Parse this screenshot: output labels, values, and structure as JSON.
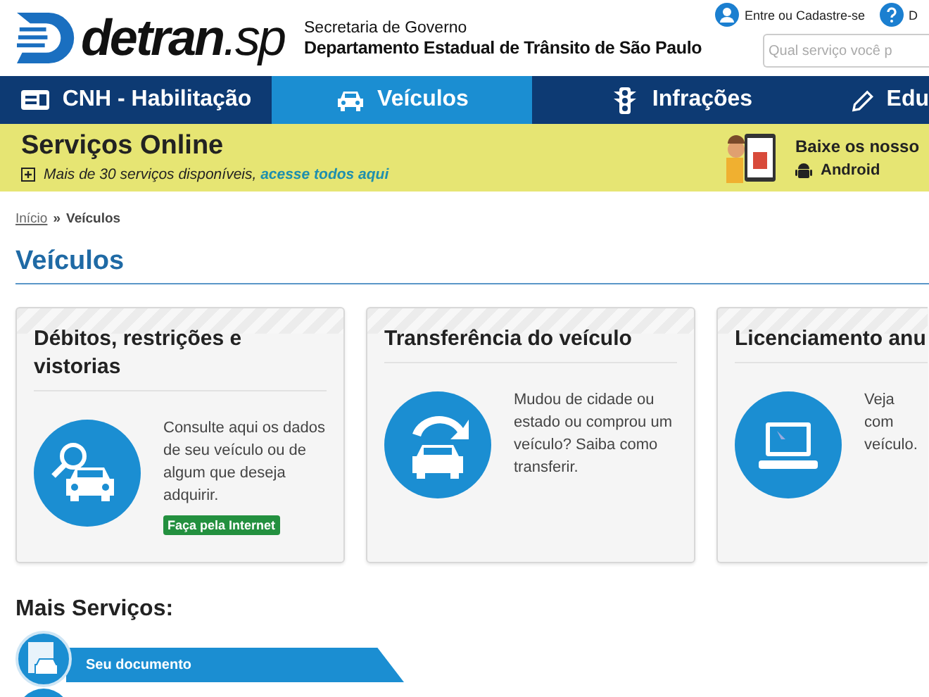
{
  "header": {
    "logo": {
      "name": "detran",
      "suffix": ".sp"
    },
    "subtitle": [
      "Secretaria de Governo",
      "Departamento Estadual de Trânsito de São Paulo"
    ],
    "account_link": "Entre ou Cadastre-se",
    "help_link": "D",
    "search": {
      "placeholder": "Qual serviço você p"
    }
  },
  "nav": [
    {
      "label": "CNH - Habilitação",
      "kind": "license",
      "selected": false
    },
    {
      "label": "Veículos",
      "kind": "car",
      "selected": true
    },
    {
      "label": "Infrações",
      "kind": "traffic-light",
      "selected": false
    },
    {
      "label": "Edu",
      "kind": "pencil",
      "selected": false
    }
  ],
  "promo": {
    "title": "Serviços Online",
    "text": "Mais de 30 serviços disponíveis, ",
    "link": "acesse todos aqui",
    "app_title": "Baixe os nosso",
    "platform": "Android"
  },
  "breadcrumb": [
    {
      "label": "Início",
      "kind": "link"
    },
    {
      "label": "»",
      "kind": "separator"
    },
    {
      "label": "Veículos",
      "kind": "current"
    }
  ],
  "heading": "Veículos",
  "cards": [
    {
      "title": "Débitos, restrições e vistorias",
      "kind": "search-car",
      "text": "Consulte aqui os dados de seu veículo ou de algum que deseja adquirir.",
      "button": "Faça pela Internet"
    },
    {
      "title": "Transferência do veículo",
      "kind": "transfer-car",
      "text": "Mudou de cidade ou estado ou comprou um veículo? Saiba como transferir."
    },
    {
      "title": "Licenciamento anu",
      "kind": "laptop",
      "text": "Veja com veículo."
    }
  ],
  "more": {
    "title": "Mais Serviços:",
    "items": [
      {
        "label": "Seu documento",
        "kind": "document"
      },
      {
        "kind": "generic"
      }
    ]
  }
}
